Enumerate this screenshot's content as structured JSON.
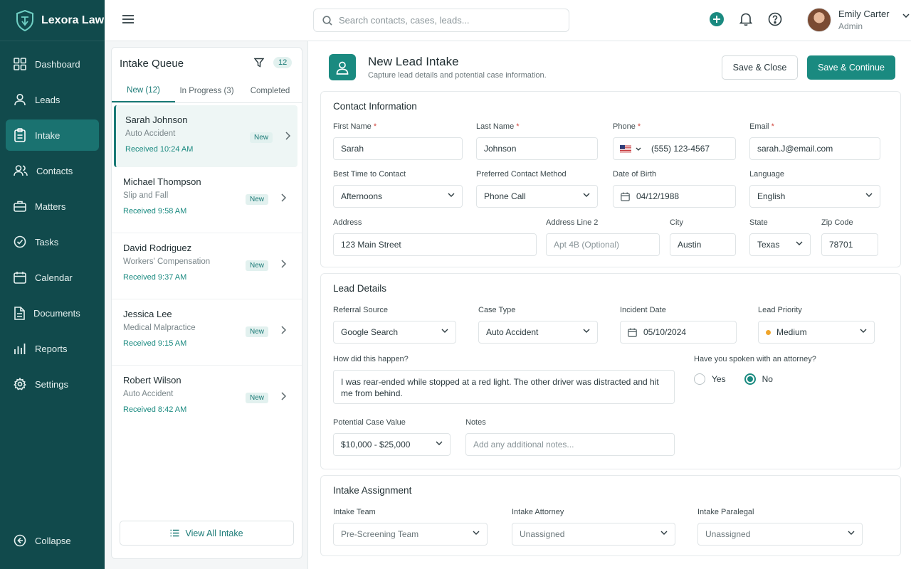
{
  "app": {
    "name": "Lexora Law"
  },
  "sidebar": {
    "items": [
      {
        "label": "Dashboard",
        "icon": "grid-icon"
      },
      {
        "label": "Leads",
        "icon": "user-icon"
      },
      {
        "label": "Intake",
        "icon": "clipboard-icon"
      },
      {
        "label": "Contacts",
        "icon": "users-icon"
      },
      {
        "label": "Matters",
        "icon": "briefcase-icon"
      },
      {
        "label": "Tasks",
        "icon": "check-circle-icon"
      },
      {
        "label": "Calendar",
        "icon": "calendar-icon"
      },
      {
        "label": "Documents",
        "icon": "document-icon"
      },
      {
        "label": "Reports",
        "icon": "bar-chart-icon"
      },
      {
        "label": "Settings",
        "icon": "gear-icon"
      }
    ],
    "active": "Intake",
    "collapse_label": "Collapse"
  },
  "topbar": {
    "search_placeholder": "Search contacts, cases, leads...",
    "user": {
      "name": "Emily Carter",
      "role": "Admin"
    }
  },
  "queue": {
    "title": "Intake Queue",
    "count": "12",
    "tabs": [
      "New (12)",
      "In Progress (3)",
      "Completed"
    ],
    "items": [
      {
        "name": "Sarah Johnson",
        "type": "Auto Accident",
        "time": "Received 10:24 AM",
        "badge": "New"
      },
      {
        "name": "Michael Thompson",
        "type": "Slip and Fall",
        "time": "Received 9:58 AM",
        "badge": "New"
      },
      {
        "name": "David Rodriguez",
        "type": "Workers' Compensation",
        "time": "Received 9:37 AM",
        "badge": "New"
      },
      {
        "name": "Jessica Lee",
        "type": "Medical Malpractice",
        "time": "Received 9:15 AM",
        "badge": "New"
      },
      {
        "name": "Robert Wilson",
        "type": "Auto Accident",
        "time": "Received 8:42 AM",
        "badge": "New"
      }
    ],
    "view_all": "View All Intake"
  },
  "form": {
    "title": "New Lead Intake",
    "subtitle": "Capture lead details and potential case information.",
    "save_close": "Save & Close",
    "save_continue": "Save & Continue",
    "contact": {
      "title": "Contact Information",
      "first_name": {
        "label": "First Name",
        "value": "Sarah"
      },
      "last_name": {
        "label": "Last Name",
        "value": "Johnson"
      },
      "phone": {
        "label": "Phone",
        "value": "(555) 123-4567"
      },
      "email": {
        "label": "Email",
        "value": "sarah.J@email.com"
      },
      "best_time": {
        "label": "Best Time to Contact",
        "value": "Afternoons"
      },
      "method": {
        "label": "Preferred Contact Method",
        "value": "Phone Call"
      },
      "dob": {
        "label": "Date of Birth",
        "value": "04/12/1988"
      },
      "language": {
        "label": "Language",
        "value": "English"
      },
      "address": {
        "label": "Address",
        "value": "123 Main Street"
      },
      "address2": {
        "label": "Address Line 2",
        "placeholder": "Apt 4B (Optional)"
      },
      "city": {
        "label": "City",
        "value": "Austin"
      },
      "state": {
        "label": "State",
        "value": "Texas"
      },
      "zip": {
        "label": "Zip Code",
        "value": "78701"
      }
    },
    "lead": {
      "title": "Lead Details",
      "referral": {
        "label": "Referral Source",
        "value": "Google Search"
      },
      "case_type": {
        "label": "Case Type",
        "value": "Auto Accident"
      },
      "incident_date": {
        "label": "Incident Date",
        "value": "05/10/2024"
      },
      "priority": {
        "label": "Lead Priority",
        "value": "Medium",
        "color": "#f0a52a"
      },
      "how": {
        "label": "How did this happen?",
        "value": "I was rear-ended while stopped at a red light. The other driver was distracted and hit me from behind."
      },
      "attorney_q": {
        "label": "Have you spoken with an attorney?",
        "options": [
          "Yes",
          "No"
        ],
        "selected": "No"
      },
      "case_value": {
        "label": "Potential Case Value",
        "value": "$10,000 - $25,000"
      },
      "notes": {
        "label": "Notes",
        "placeholder": "Add any additional notes..."
      }
    },
    "assignment": {
      "title": "Intake Assignment",
      "team": {
        "label": "Intake Team",
        "value": "Pre-Screening Team"
      },
      "attorney": {
        "label": "Intake Attorney",
        "value": "Unassigned"
      },
      "paralegal": {
        "label": "Intake Paralegal",
        "value": "Unassigned"
      }
    }
  },
  "colors": {
    "sidebar": "#114a4c",
    "accent": "#1a8a80",
    "active_nav": "#1a7270"
  }
}
